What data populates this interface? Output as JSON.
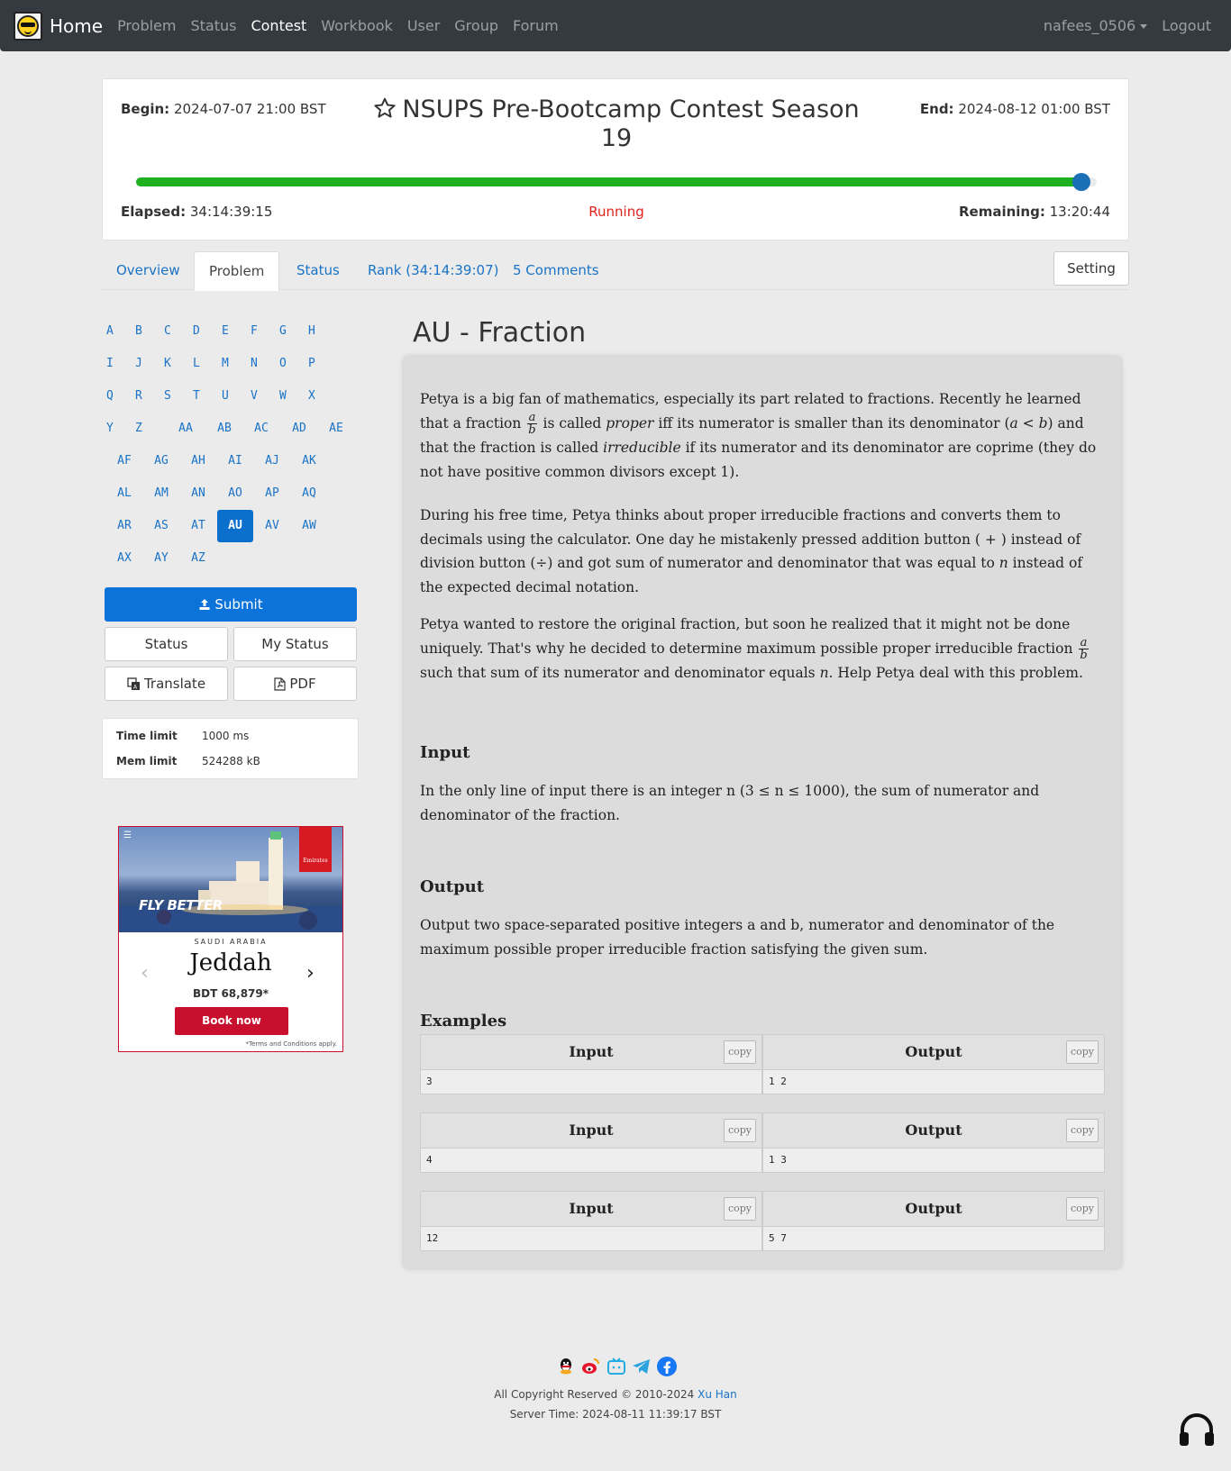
{
  "nav": {
    "brand": "Home",
    "links": [
      "Problem",
      "Status",
      "Contest",
      "Workbook",
      "User",
      "Group",
      "Forum"
    ],
    "active": "Contest",
    "user": "nafees_0506",
    "logout": "Logout"
  },
  "contest": {
    "begin_label": "Begin:",
    "begin": "2024-07-07 21:00 BST",
    "end_label": "End:",
    "end": "2024-08-12 01:00 BST",
    "title": "NSUPS Pre-Bootcamp Contest Season 19",
    "elapsed_label": "Elapsed:",
    "elapsed": "34:14:39:15",
    "status": "Running",
    "remaining_label": "Remaining:",
    "remaining": "13:20:44",
    "progress_percent": 98.4,
    "colors": {
      "progress": "#1eb01e",
      "status": "#e0221b",
      "link": "#1a73c7"
    }
  },
  "tabs": {
    "overview": "Overview",
    "problem": "Problem",
    "status": "Status",
    "rank": "Rank (34:14:39:07)",
    "comments": "5 Comments",
    "setting": "Setting"
  },
  "problem_letters": [
    [
      "A",
      "B",
      "C",
      "D",
      "E",
      "F",
      "G",
      "H"
    ],
    [
      "I",
      "J",
      "K",
      "L",
      "M",
      "N",
      "O",
      "P"
    ],
    [
      "Q",
      "R",
      "S",
      "T",
      "U",
      "V",
      "W",
      "X"
    ],
    [
      "Y",
      "Z",
      "AA",
      "AB",
      "AC",
      "AD",
      "AE"
    ],
    [
      "AF",
      "AG",
      "AH",
      "AI",
      "AJ",
      "AK"
    ],
    [
      "AL",
      "AM",
      "AN",
      "AO",
      "AP",
      "AQ"
    ],
    [
      "AR",
      "AS",
      "AT",
      "AU",
      "AV",
      "AW"
    ],
    [
      "AX",
      "AY",
      "AZ"
    ]
  ],
  "active_letter": "AU",
  "side_buttons": {
    "submit": "Submit",
    "status": "Status",
    "my_status": "My Status",
    "translate": "Translate",
    "pdf": "PDF"
  },
  "limits": {
    "time_label": "Time limit",
    "time": "1000 ms",
    "mem_label": "Mem limit",
    "mem": "524288 kB"
  },
  "ad": {
    "slogan": "FLY BETTER",
    "brand": "Emirates",
    "country": "SAUDI ARABIA",
    "city": "Jeddah",
    "price": "BDT 68,879*",
    "cta": "Book now",
    "terms": "*Terms and Conditions apply."
  },
  "problem": {
    "title": "AU - Fraction",
    "input_heading": "Input",
    "output_heading": "Output",
    "examples_heading": "Examples",
    "input_text": "In the only line of input there is an integer n (3 ≤ n ≤ 1000), the sum of numerator and denominator of the fraction.",
    "output_text": "Output two space-separated positive integers a and b, numerator and denominator of the maximum possible proper irreducible fraction satisfying the given sum."
  },
  "examples": [
    {
      "input_label": "Input",
      "output_label": "Output",
      "copy": "copy",
      "input": "3",
      "output": "1 2"
    },
    {
      "input_label": "Input",
      "output_label": "Output",
      "copy": "copy",
      "input": "4",
      "output": "1 3"
    },
    {
      "input_label": "Input",
      "output_label": "Output",
      "copy": "copy",
      "input": "12",
      "output": "5 7"
    }
  ],
  "footer": {
    "copyright_prefix": "All Copyright Reserved © 2010-2024 ",
    "author": "Xu Han",
    "server_time": "Server Time: 2024-08-11 11:39:17 BST"
  }
}
